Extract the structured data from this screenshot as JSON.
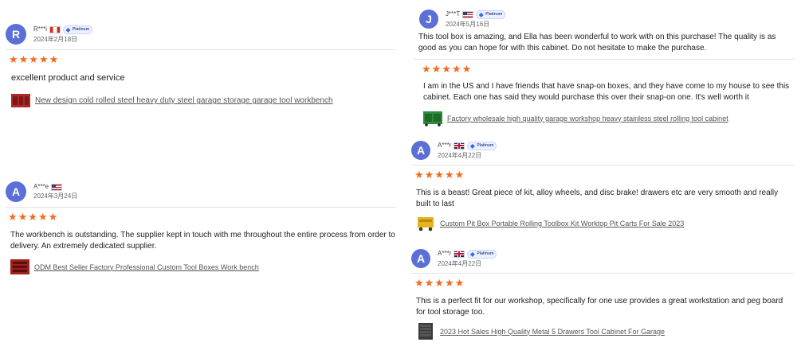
{
  "reviews": [
    {
      "avatar": "R",
      "name": "R***i",
      "country": "Canada",
      "flag_icon": "flag-ca-icon",
      "badge": "Platinum",
      "date": "2024年2月18日",
      "rating": "★★★★★",
      "pre_text": "",
      "text": "excellent product and service",
      "product": "New design cold rolled steel heavy duty steel garage storage garage tool workbench",
      "thumb_color": "#b0282a"
    },
    {
      "avatar": "A",
      "name": "A***e",
      "country": "United States",
      "flag_icon": "flag-us-icon",
      "badge": "",
      "date": "2024年3月24日",
      "rating": "★★★★★",
      "pre_text": "",
      "text": "The workbench is outstanding. The supplier kept in touch with me throughout the entire process from order to delivery. An extremely dedicated supplier.",
      "product": "ODM Best Seller Factory Professional Custom Tool Boxes Work bench",
      "thumb_color": "#a01f1f"
    },
    {
      "avatar": "J",
      "name": "J***T",
      "country": "United States",
      "flag_icon": "flag-us-icon",
      "badge": "Platinum",
      "date": "2024年5月16日",
      "rating": "★★★★★",
      "pre_text": "This tool box is amazing, and Ella has been wonderful to work with on this purchase! The quality is as good as you can hope for with this cabinet. Do not hesitate to make the purchase.",
      "text": "I am in the US and I have friends that have snap-on boxes, and they have come to my house to see this cabinet. Each one has said they would purchase this over their snap-on one. It's well worth it",
      "product": "Factory wholesale high quality garage workshop heavy stainless steel rolling tool cabinet",
      "thumb_color": "#2e8b3a"
    },
    {
      "avatar": "A",
      "name": "A***r",
      "country": "United Kingdom",
      "flag_icon": "flag-uk-icon",
      "badge": "Platinum",
      "date": "2024年4月22日",
      "rating": "★★★★★",
      "pre_text": "",
      "text": "This is a beast! Great piece of kit, alloy wheels, and disc brake! drawers etc are very smooth and really built to last",
      "product": "Custom Pit Box Portable Rolling Toolbox Kit Worktop Pit Carts For Sale 2023",
      "thumb_color": "#e6b31e"
    },
    {
      "avatar": "A",
      "name": "A***r",
      "country": "United Kingdom",
      "flag_icon": "flag-uk-icon",
      "badge": "Platinum",
      "date": "2024年4月22日",
      "rating": "★★★★★",
      "pre_text": "",
      "text": "This is a perfect fit for our workshop, specifically for one use provides a great workstation and peg board for tool storage too.",
      "product": "2023 Hot Sales High Quality Metal 5 Drawers Tool Cabinet For Garage",
      "thumb_color": "#3a3a3a"
    }
  ]
}
